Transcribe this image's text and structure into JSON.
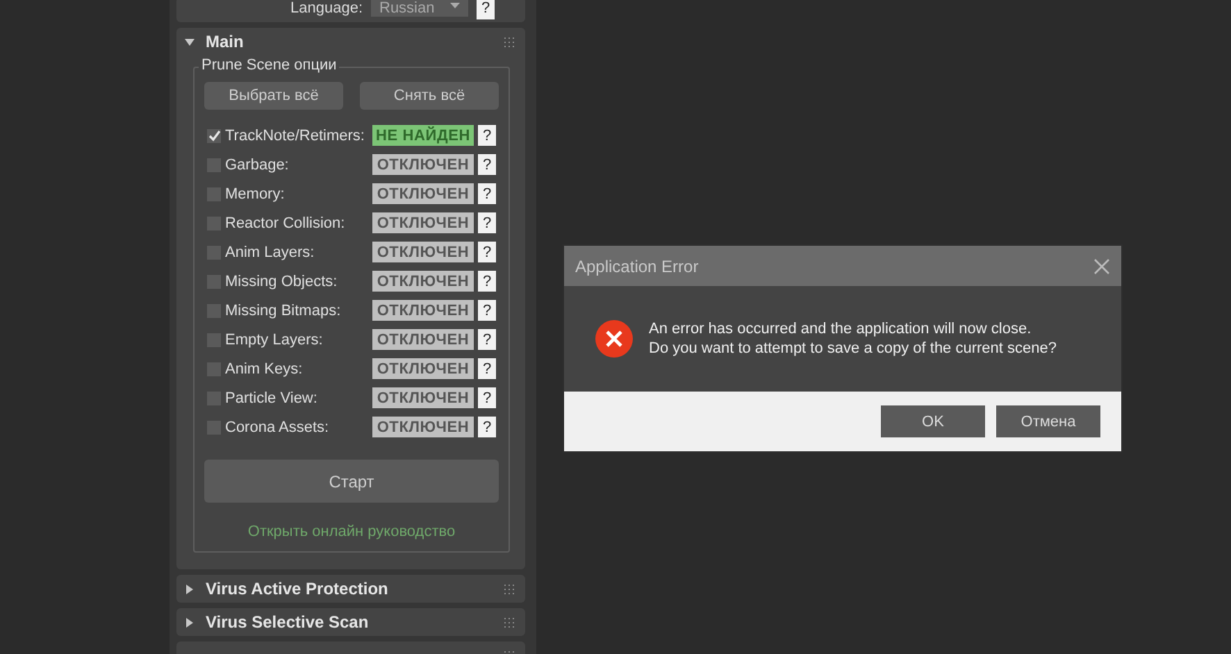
{
  "language": {
    "label": "Language:",
    "value": "Russian",
    "help": "?"
  },
  "main": {
    "title": "Main",
    "expanded": true,
    "group_title": "Prune Scene опции",
    "buttons": [
      "Выбрать всё",
      "Снять всё"
    ],
    "options": [
      {
        "label": "TrackNote/Retimers:",
        "checked": true,
        "status": "НЕ НАЙДЕН",
        "kind": "found",
        "help": "?"
      },
      {
        "label": "Garbage:",
        "checked": false,
        "status": "ОТКЛЮЧЕН",
        "kind": "off",
        "help": "?"
      },
      {
        "label": "Memory:",
        "checked": false,
        "status": "ОТКЛЮЧЕН",
        "kind": "off",
        "help": "?"
      },
      {
        "label": "Reactor Collision:",
        "checked": false,
        "status": "ОТКЛЮЧЕН",
        "kind": "off",
        "help": "?"
      },
      {
        "label": "Anim Layers:",
        "checked": false,
        "status": "ОТКЛЮЧЕН",
        "kind": "off",
        "help": "?"
      },
      {
        "label": "Missing Objects:",
        "checked": false,
        "status": "ОТКЛЮЧЕН",
        "kind": "off",
        "help": "?"
      },
      {
        "label": "Missing Bitmaps:",
        "checked": false,
        "status": "ОТКЛЮЧЕН",
        "kind": "off",
        "help": "?"
      },
      {
        "label": "Empty Layers:",
        "checked": false,
        "status": "ОТКЛЮЧЕН",
        "kind": "off",
        "help": "?"
      },
      {
        "label": "Anim Keys:",
        "checked": false,
        "status": "ОТКЛЮЧЕН",
        "kind": "off",
        "help": "?"
      },
      {
        "label": "Particle View:",
        "checked": false,
        "status": "ОТКЛЮЧЕН",
        "kind": "off",
        "help": "?"
      },
      {
        "label": "Corona Assets:",
        "checked": false,
        "status": "ОТКЛЮЧЕН",
        "kind": "off",
        "help": "?"
      }
    ],
    "start_button": "Старт",
    "link": "Открыть онлайн руководство"
  },
  "rollouts": [
    {
      "title": "Virus Active Protection",
      "expanded": false
    },
    {
      "title": "Virus Selective Scan",
      "expanded": false
    }
  ],
  "dialog": {
    "title": "Application Error",
    "message": [
      "An error has occurred and the application will now close.",
      "Do you want to attempt to save a copy of the current scene?"
    ],
    "buttons": [
      "OK",
      "Отмена"
    ]
  }
}
